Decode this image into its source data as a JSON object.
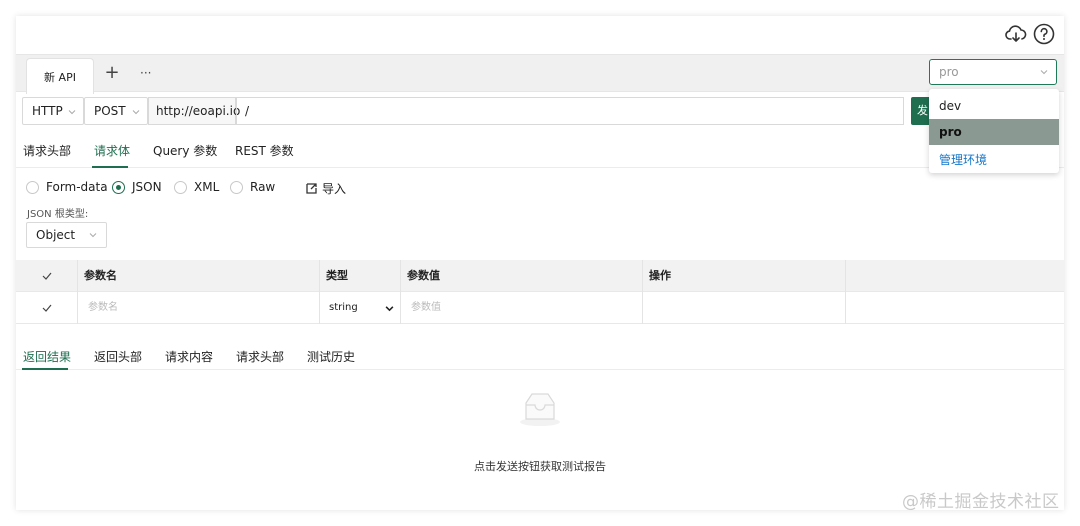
{
  "tabs": {
    "active_label": "新 API",
    "add_symbol": "+",
    "more_symbol": "···"
  },
  "env": {
    "placeholder": "pro",
    "options": [
      "dev",
      "pro"
    ],
    "selected": "pro",
    "manage_label": "管理环境"
  },
  "request": {
    "protocol": "HTTP",
    "method": "POST",
    "host": "http://eoapi.io",
    "path": "/",
    "send_label": "发"
  },
  "request_tabs": [
    "请求头部",
    "请求体",
    "Query 参数",
    "REST 参数"
  ],
  "body_types": [
    "Form-data",
    "JSON",
    "XML",
    "Raw"
  ],
  "body_type_selected": "JSON",
  "import_label": "导入",
  "root_type_label": "JSON 根类型:",
  "root_type_value": "Object",
  "params_table": {
    "headers": [
      "参数名",
      "类型",
      "参数值",
      "操作"
    ],
    "row": {
      "name_placeholder": "参数名",
      "type": "string",
      "value_placeholder": "参数值"
    }
  },
  "response_tabs": [
    "返回结果",
    "返回头部",
    "请求内容",
    "请求头部",
    "测试历史"
  ],
  "empty_text": "点击发送按钮获取测试报告",
  "watermark": "@稀土掘金技术社区",
  "colors": {
    "accent": "#1f6e50",
    "link": "#1677cc",
    "selected_option_bg": "#8a9a92"
  }
}
